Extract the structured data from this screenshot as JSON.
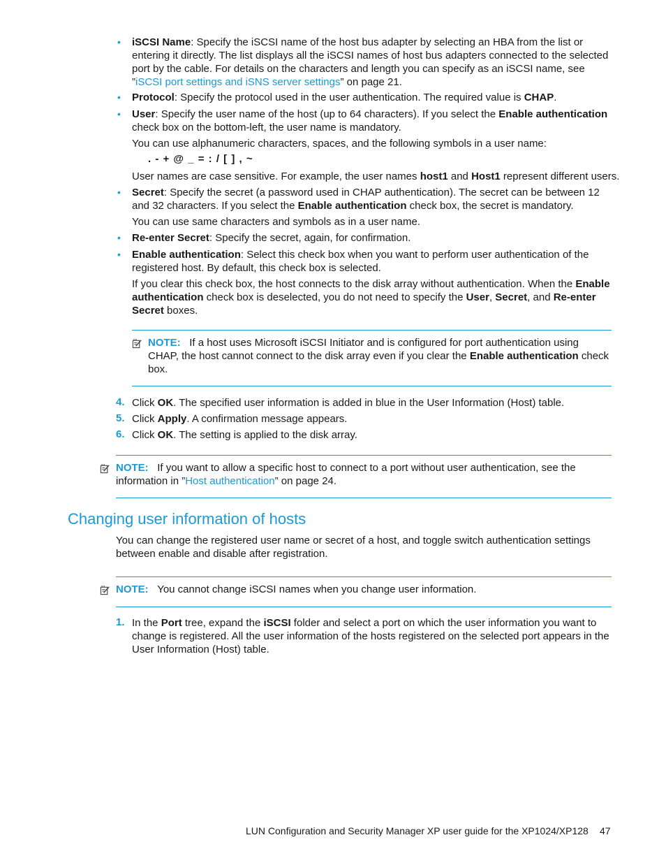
{
  "colors": {
    "accent": "#1a9ad6",
    "text": "#1a1a1a"
  },
  "bullets": [
    {
      "term": "iSCSI Name",
      "text": ": Specify the iSCSI name of the host bus adapter by selecting an HBA from the list or entering it directly. The list displays all the iSCSI names of host bus adapters connected to the selected port by the cable. For details on the characters and length you can specify as an iSCSI name, see ”",
      "link": "iSCSI port settings and iSNS server settings",
      "after": "” on page 21."
    },
    {
      "term": "Protocol",
      "text": ": Specify the protocol used in the user authentication. The required value is ",
      "bold_value": "CHAP",
      "after": "."
    },
    {
      "term": "User",
      "text": ": Specify the user name of the host (up to 64 characters). If you select the ",
      "bold_value": "Enable authentication",
      "after": " check box on the bottom-left, the user name is mandatory.",
      "para1": "You can use alphanumeric characters, spaces, and the following symbols in a user name:",
      "symbols": ". - + @ _ = : / [ ] , ~",
      "para2_a": "User names are case sensitive. For example, the user names ",
      "para2_b": "host1",
      "para2_c": " and ",
      "para2_d": "Host1",
      "para2_e": " represent different users."
    },
    {
      "term": "Secret",
      "text": ": Specify the secret (a password used in CHAP authentication). The secret can be between 12 and 32 characters. If you select the ",
      "bold_value": "Enable authentication",
      "after": " check box, the secret is mandatory.",
      "para1": "You can use same characters and symbols as in a user name."
    },
    {
      "term": "Re-enter Secret",
      "text": ": Specify the secret, again, for confirmation."
    },
    {
      "term": "Enable authentication",
      "text": ": Select this check box when you want to perform user authentication of the registered host. By default, this check box is selected.",
      "para1_a": "If you clear this check box, the host connects to the disk array without authentication. When the ",
      "para1_b": "Enable authentication",
      "para1_c": " check box is deselected, you do not need to specify the ",
      "para1_d": "User",
      "para1_e": ", ",
      "para1_f": "Secret",
      "para1_g": ", and ",
      "para1_h": "Re-enter Secret",
      "para1_i": " boxes."
    }
  ],
  "note1": {
    "label": "NOTE:",
    "text_a": "If a host uses Microsoft iSCSI Initiator and is configured for port authentication using CHAP, the host cannot connect to the disk array even if you clear the ",
    "bold": "Enable authentication",
    "text_b": " check box."
  },
  "steps": [
    {
      "num": "4.",
      "a": "Click ",
      "b": "OK",
      "c": ". The specified user information is added in blue in the User Information (Host) table."
    },
    {
      "num": "5.",
      "a": "Click ",
      "b": "Apply",
      "c": ". A confirmation message appears."
    },
    {
      "num": "6.",
      "a": "Click ",
      "b": "OK",
      "c": ". The setting is applied to the disk array."
    }
  ],
  "note2": {
    "label": "NOTE:",
    "text_a": "If you want to allow a specific host to connect to a port without user authentication, see the information in ”",
    "link": "Host authentication",
    "text_b": "” on page 24."
  },
  "section": {
    "heading": "Changing user information of hosts",
    "intro": "You can change the registered user name or secret of a host, and toggle switch authentication settings between enable and disable after registration.",
    "note": {
      "label": "NOTE:",
      "text": "You cannot change iSCSI names when you change user information."
    },
    "steps": [
      {
        "num": "1.",
        "a": "In the ",
        "b": "Port",
        "c": " tree, expand the ",
        "d": "iSCSI",
        "e": " folder and select a port on which the user information you want to change is registered. All the user information of the hosts registered on the selected port appears in the User Information (Host) table."
      }
    ]
  },
  "footer": {
    "title": "LUN Configuration and Security Manager XP user guide for the XP1024/XP128",
    "page_number": "47"
  }
}
